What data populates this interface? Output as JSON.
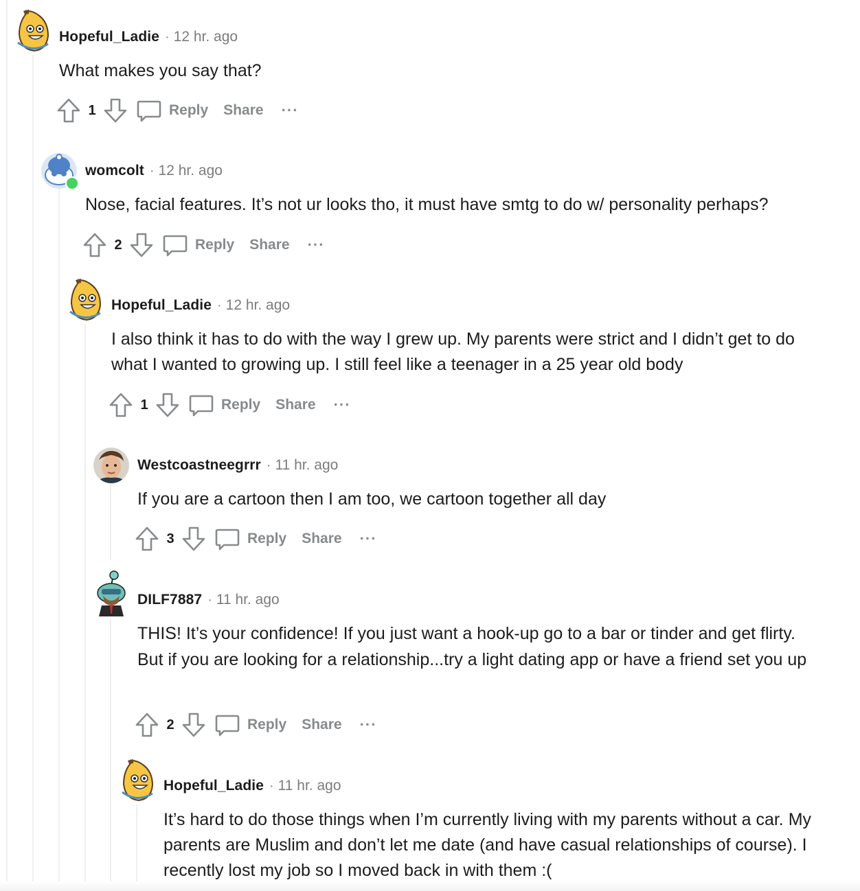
{
  "comments": [
    {
      "username": "Hopeful_Ladie",
      "time": "12 hr. ago",
      "body": "What makes you say that?",
      "score": "1",
      "reply": "Reply",
      "share": "Share",
      "more": "···"
    },
    {
      "username": "womcolt",
      "time": "12 hr. ago",
      "body": "Nose, facial features. It’s not ur looks tho, it must have smtg to do w/ personality perhaps?",
      "score": "2",
      "reply": "Reply",
      "share": "Share",
      "more": "···"
    },
    {
      "username": "Hopeful_Ladie",
      "time": "12 hr. ago",
      "body": "I also think it has to do with the way I grew up. My parents were strict and I didn’t get to do what I wanted to growing up. I still feel like a teenager in a 25 year old body",
      "score": "1",
      "reply": "Reply",
      "share": "Share",
      "more": "···"
    },
    {
      "username": "Westcoastneegrrr",
      "time": "11 hr. ago",
      "body": "If you are a cartoon then I am too, we cartoon together all day",
      "score": "3",
      "reply": "Reply",
      "share": "Share",
      "more": "···"
    },
    {
      "username": "DILF7887",
      "time": "11 hr. ago",
      "body": "THIS! It’s your confidence! If you just want a hook-up go to a bar or tinder and get flirty. But if you are looking for a relationship...try a light dating app or have a friend set you up",
      "score": "2",
      "reply": "Reply",
      "share": "Share",
      "more": "···"
    },
    {
      "username": "Hopeful_Ladie",
      "time": "11 hr. ago",
      "body": "It’s hard to do those things when I’m currently living with my parents without a car. My parents are Muslim and don’t let me date (and have casual relationships of course). I recently lost my job so I moved back in with them :("
    }
  ],
  "colors": {
    "text": "#1c1c1c",
    "meta": "#878a8c",
    "thread": "#edeff1",
    "online": "#46d160"
  }
}
